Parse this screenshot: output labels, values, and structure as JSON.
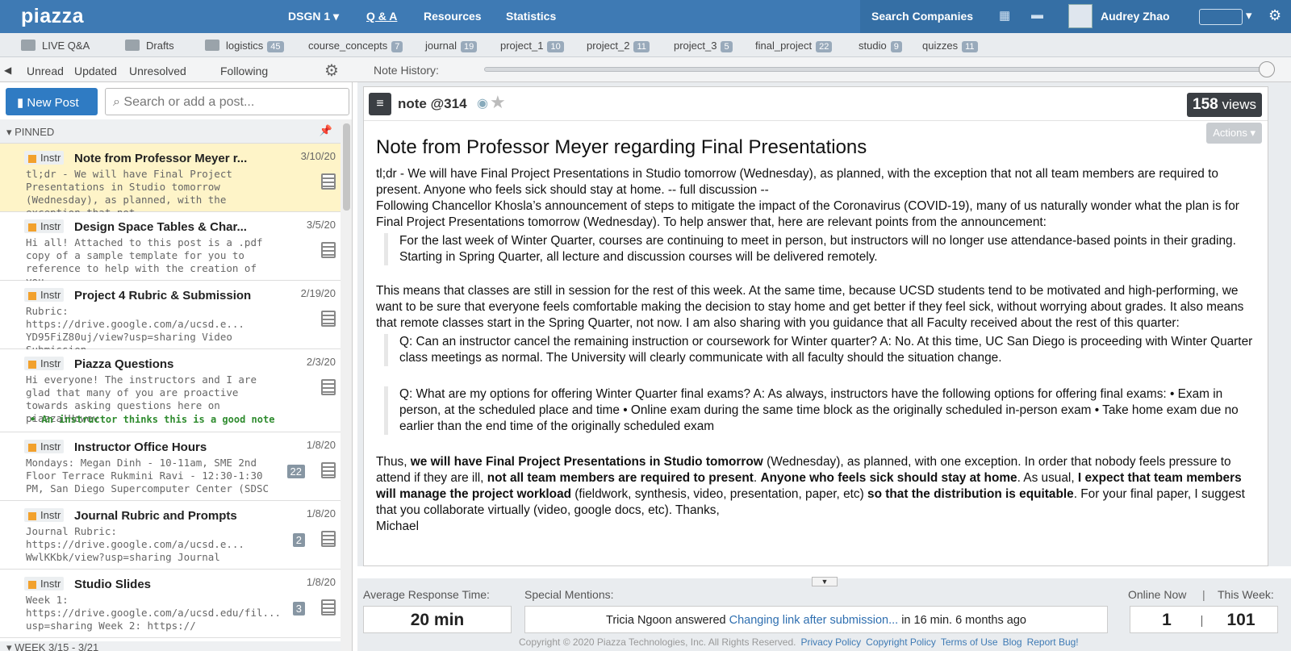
{
  "app": {
    "logo": "piazza",
    "course": "DSGN 1 ▾",
    "nav": [
      "Q & A",
      "Resources",
      "Statistics"
    ],
    "search_companies": "Search Companies",
    "user": "Audrey Zhao"
  },
  "folders": [
    {
      "label": "LIVE Q&A",
      "count": ""
    },
    {
      "label": "Drafts",
      "count": ""
    },
    {
      "label": "logistics",
      "count": "45"
    },
    {
      "label": "course_concepts",
      "count": "7"
    },
    {
      "label": "journal",
      "count": "19"
    },
    {
      "label": "project_1",
      "count": "10"
    },
    {
      "label": "project_2",
      "count": "11"
    },
    {
      "label": "project_3",
      "count": "5"
    },
    {
      "label": "final_project",
      "count": "22"
    },
    {
      "label": "studio",
      "count": "9"
    },
    {
      "label": "quizzes",
      "count": "11"
    }
  ],
  "filters": [
    "Unread",
    "Updated",
    "Unresolved",
    "Following"
  ],
  "note_history_label": "Note History:",
  "left": {
    "new_post": "New Post",
    "search_placeholder": "Search or add a post...",
    "pinned_label": "PINNED",
    "week_label": "WEEK 3/15 - 3/21"
  },
  "posts": [
    {
      "tag": "Instr",
      "title": "Note from Professor Meyer r...",
      "date": "3/10/20",
      "snippet": "tl;dr - We will have Final Project Presentations in Studio tomorrow (Wednesday), as planned, with the exception that not",
      "count": ""
    },
    {
      "tag": "Instr",
      "title": "Design Space Tables & Char...",
      "date": "3/5/20",
      "snippet": "Hi all! Attached to this post is a .pdf copy of a sample template for you to reference to help with the creation of you",
      "count": ""
    },
    {
      "tag": "Instr",
      "title": "Project 4 Rubric & Submission",
      "date": "2/19/20",
      "snippet": "Rubric: https://drive.google.com/a/ucsd.e... YD95FiZ80uj/view?usp=sharing  Video Submission",
      "count": ""
    },
    {
      "tag": "Instr",
      "title": "Piazza Questions",
      "date": "2/3/20",
      "snippet": "Hi everyone! The instructors and I are glad that many of you are proactive towards asking questions here on piazza!Howev",
      "count": "",
      "good": "• An instructor thinks this is a good note"
    },
    {
      "tag": "Instr",
      "title": "Instructor Office Hours",
      "date": "1/8/20",
      "snippet": "Mondays: Megan Dinh - 10-11am, SME 2nd Floor Terrace Rukmini Ravi - 12:30-1:30 PM, San Diego Supercomputer Center (SDSC",
      "count": "22"
    },
    {
      "tag": "Instr",
      "title": "Journal Rubric and Prompts",
      "date": "1/8/20",
      "snippet": "Journal Rubric: https://drive.google.com/a/ucsd.e... WwlKKbk/view?usp=sharing  Journal",
      "count": "2"
    },
    {
      "tag": "Instr",
      "title": "Studio Slides",
      "date": "1/8/20",
      "snippet": "Week 1: https://drive.google.com/a/ucsd.edu/fil... usp=sharing  Week 2: https://",
      "count": "3"
    }
  ],
  "note": {
    "label": "note @314",
    "views_num": "158",
    "views_word": "views",
    "actions": "Actions ▾",
    "title": "Note from Professor Meyer regarding Final Presentations",
    "p1": "tl;dr - We will have Final Project Presentations in Studio tomorrow (Wednesday), as planned, with the exception that not all team members are required to present. Anyone who feels sick should stay at home. -- full discussion --",
    "p2": "Following Chancellor Khosla’s announcement of steps to mitigate the impact of the Coronavirus (COVID-19), many of us naturally wonder what the plan is for Final Project Presentations tomorrow (Wednesday). To help answer that, here are relevant points from the announcement:",
    "q1": "For the last week of Winter Quarter, courses are continuing to meet in person, but instructors will no longer use attendance-based points in their grading. Starting in Spring Quarter, all lecture and discussion courses will be delivered remotely.",
    "p3": "This means that classes are still in session for the rest of this week. At the same time, because UCSD students tend to be motivated and high-performing, we want to be sure that everyone feels comfortable making the decision to stay home and get better if they feel sick, without worrying about grades. It also means that remote classes start in the Spring Quarter, not now. I am also sharing with you guidance that all Faculty received about the rest of this quarter:",
    "q2": "Q:  Can an instructor cancel the remaining instruction or coursework for Winter quarter? A: No. At this time, UC San Diego is proceeding with Winter Quarter class meetings as normal. The University will clearly communicate with all faculty should the situation change.",
    "q3": "Q: What are my options for offering Winter Quarter final exams? A: As always, instructors have the following options for offering final exams: • Exam in person, at the scheduled place and time • Online exam during the same time block as the originally scheduled in-person exam • Take home exam due no earlier than the end time of the originally scheduled exam",
    "p4a": "Thus, ",
    "p4b": "we will have Final Project Presentations in Studio tomorrow",
    "p4c": " (Wednesday), as planned, with one exception. In order that nobody feels pressure to attend if they are ill, ",
    "p4d": "not all team members are required to present",
    "p4e": ".  ",
    "p4f": "Anyone who feels sick should stay at home",
    "p4g": ". As usual, ",
    "p4h": "I expect that team members will manage the project workload",
    "p4i": " (fieldwork, synthesis, video, presentation, paper, etc) ",
    "p4j": "so that the distribution is equitable",
    "p4k": ". For your final paper, I suggest that you collaborate virtually (video, google docs, etc). Thanks,",
    "sign": "Michael"
  },
  "stats": {
    "avg_label": "Average Response Time:",
    "avg_value": "20 min",
    "mentions_label": "Special Mentions:",
    "mention_pre": "Tricia Ngoon answered ",
    "mention_link": "Changing link after submission...",
    "mention_post": " in 16 min. 6 months ago",
    "online_label": "Online Now",
    "sep": "|",
    "week_label": "This Week:",
    "online_value": "1",
    "week_value": "101"
  },
  "footer": {
    "copyright": "Copyright © 2020 Piazza Technologies, Inc. All Rights Reserved.",
    "links": [
      "Privacy Policy",
      "Copyright Policy",
      "Terms of Use",
      "Blog",
      "Report Bug!"
    ]
  }
}
